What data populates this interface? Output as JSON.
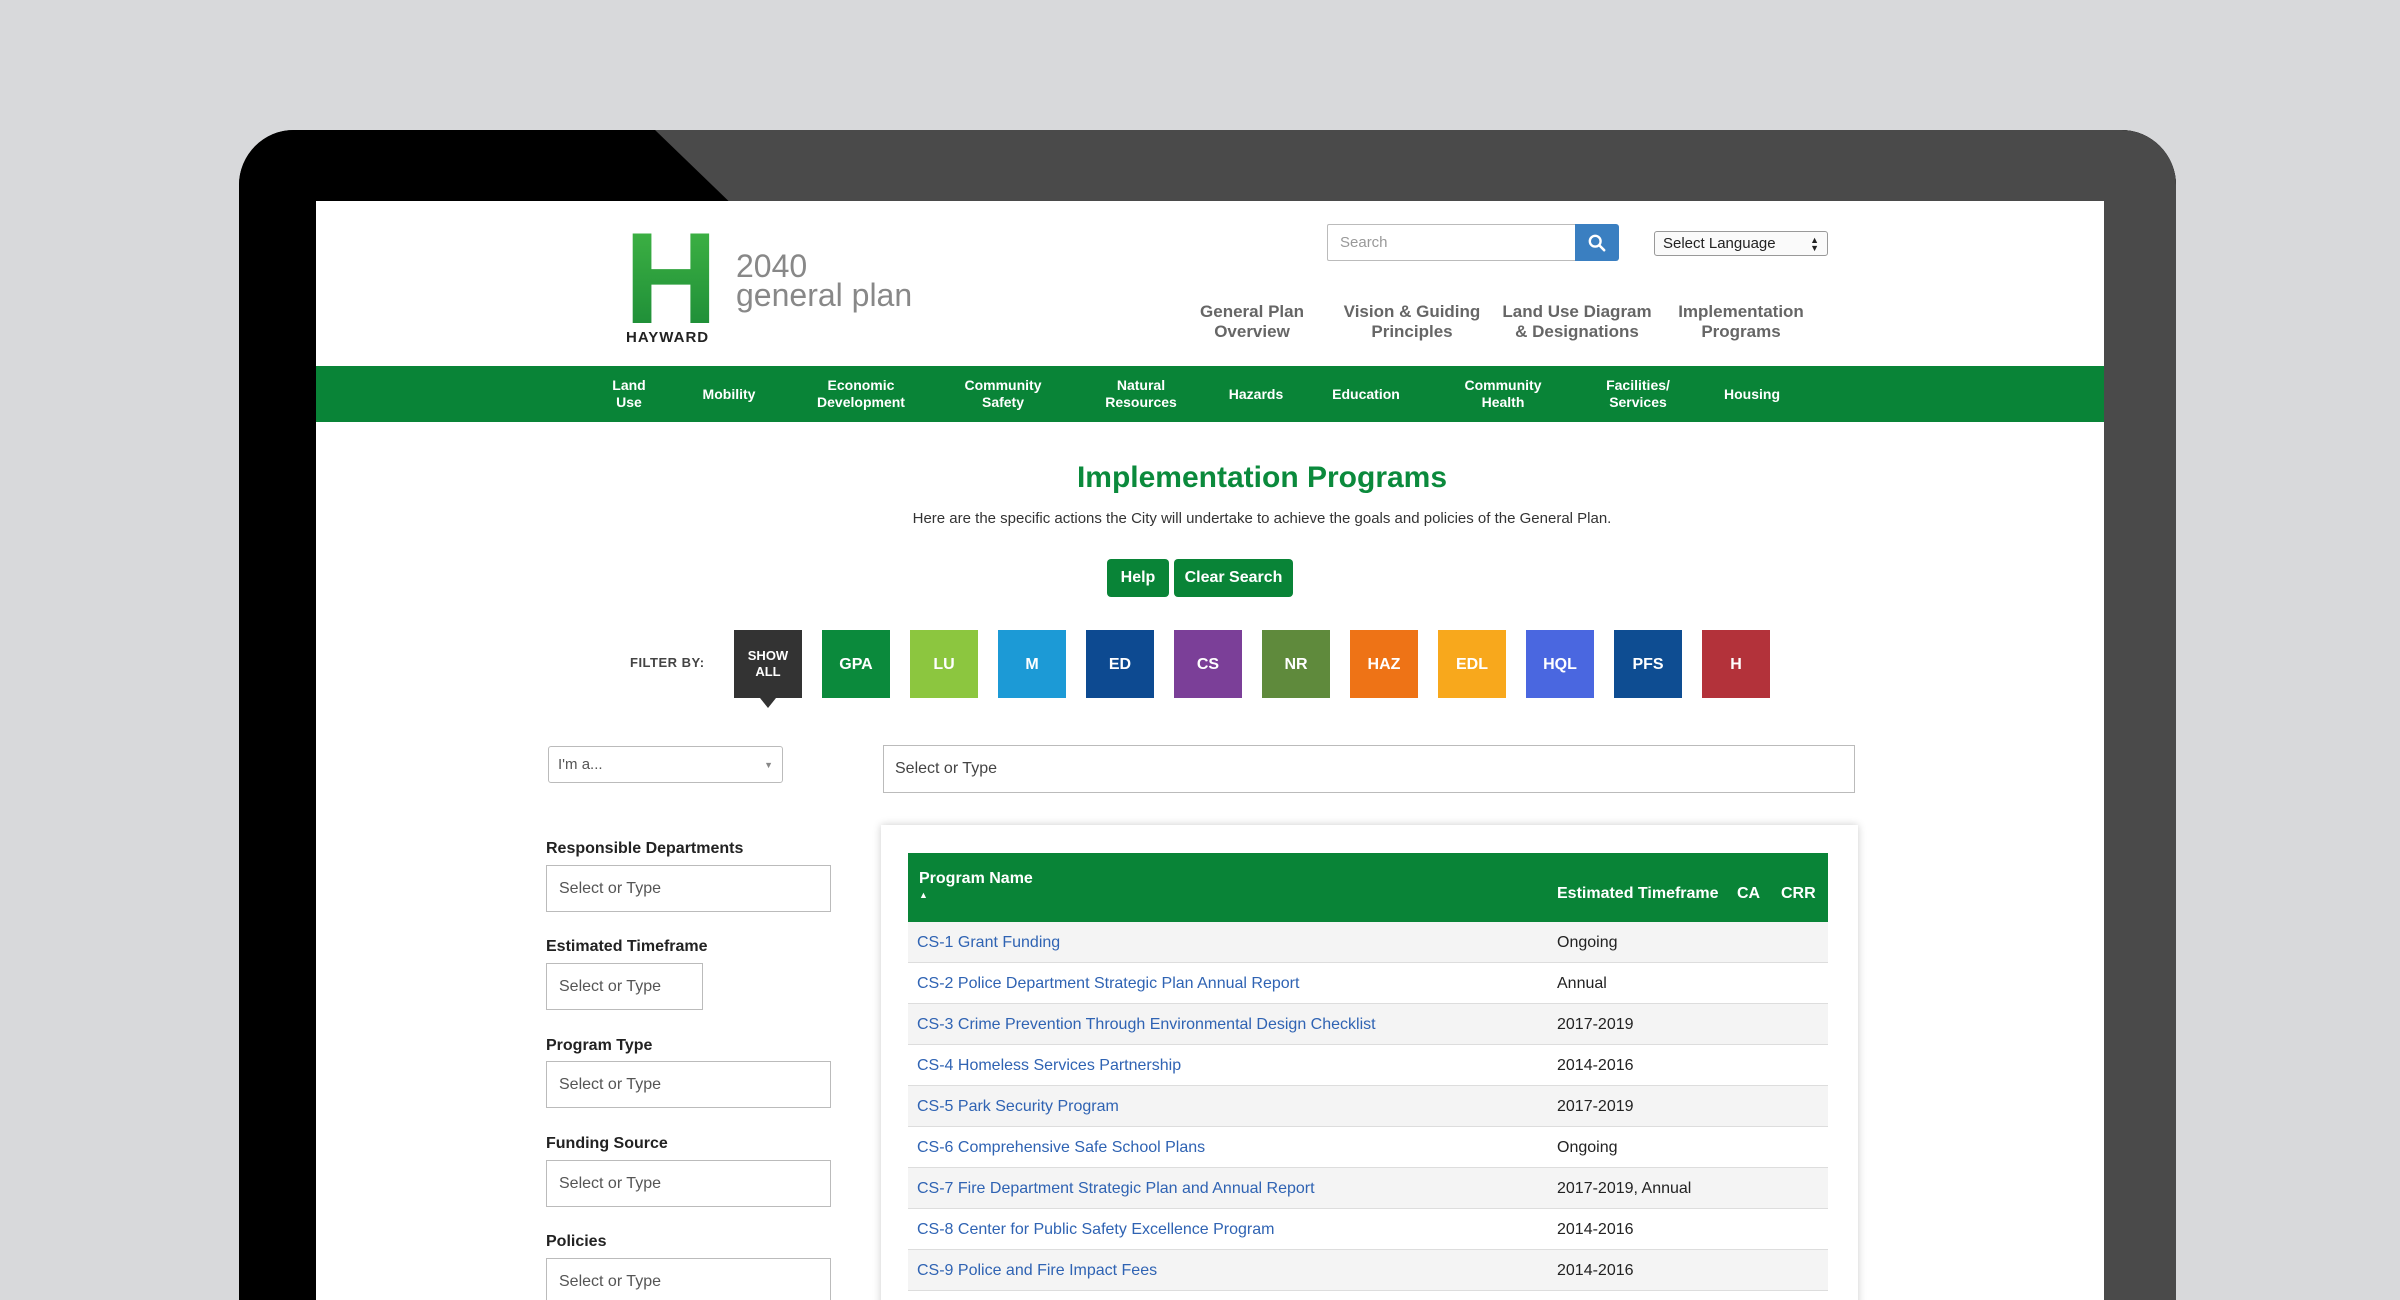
{
  "brand": {
    "year": "2040",
    "plan": "general plan",
    "city": "HAYWARD",
    "logo_letter": "H"
  },
  "header": {
    "search_placeholder": "Search",
    "language_select": "Select Language",
    "nav": [
      {
        "line1": "General Plan",
        "line2": "Overview"
      },
      {
        "line1": "Vision & Guiding",
        "line2": "Principles"
      },
      {
        "line1": "Land Use Diagram",
        "line2": "& Designations"
      },
      {
        "line1": "Implementation",
        "line2": "Programs"
      }
    ]
  },
  "greenbar": [
    {
      "line1": "Land",
      "line2": "Use"
    },
    {
      "line1": "Mobility",
      "line2": ""
    },
    {
      "line1": "Economic",
      "line2": "Development"
    },
    {
      "line1": "Community",
      "line2": "Safety"
    },
    {
      "line1": "Natural",
      "line2": "Resources"
    },
    {
      "line1": "Hazards",
      "line2": ""
    },
    {
      "line1": "Education",
      "line2": ""
    },
    {
      "line1": "Community",
      "line2": "Health"
    },
    {
      "line1": "Facilities/",
      "line2": "Services"
    },
    {
      "line1": "Housing",
      "line2": ""
    }
  ],
  "page": {
    "title": "Implementation Programs",
    "subtitle": "Here are the specific actions the City will undertake to achieve the goals and policies of the General Plan.",
    "help_label": "Help",
    "clear_label": "Clear Search"
  },
  "filter": {
    "label": "FILTER BY:",
    "tiles": [
      {
        "line1": "SHOW",
        "line2": "ALL",
        "color": "#333333"
      },
      {
        "line1": "GPA",
        "line2": "",
        "color": "#0b8a3c"
      },
      {
        "line1": "LU",
        "line2": "",
        "color": "#8cc63f"
      },
      {
        "line1": "M",
        "line2": "",
        "color": "#1c9ad6"
      },
      {
        "line1": "ED",
        "line2": "",
        "color": "#0d4a91"
      },
      {
        "line1": "CS",
        "line2": "",
        "color": "#7b3f98"
      },
      {
        "line1": "NR",
        "line2": "",
        "color": "#5f8a3c"
      },
      {
        "line1": "HAZ",
        "line2": "",
        "color": "#ee7316"
      },
      {
        "line1": "EDL",
        "line2": "",
        "color": "#f8a81c"
      },
      {
        "line1": "HQL",
        "line2": "",
        "color": "#4a67e0"
      },
      {
        "line1": "PFS",
        "line2": "",
        "color": "#0e4d92"
      },
      {
        "line1": "H",
        "line2": "",
        "color": "#b3323a"
      }
    ]
  },
  "search": {
    "ima_placeholder": "I'm a...",
    "main_placeholder": "Select or Type"
  },
  "sidebar": [
    {
      "label": "Responsible Departments",
      "placeholder": "Select or Type"
    },
    {
      "label": "Estimated Timeframe",
      "placeholder": "Select or Type"
    },
    {
      "label": "Program Type",
      "placeholder": "Select or Type"
    },
    {
      "label": "Funding Source",
      "placeholder": "Select or Type"
    },
    {
      "label": "Policies",
      "placeholder": "Select or Type"
    }
  ],
  "table": {
    "columns": {
      "name": "Program Name",
      "timeframe": "Estimated Timeframe",
      "ca": "CA",
      "crr": "CRR"
    },
    "rows": [
      {
        "name": "CS-1 Grant Funding",
        "timeframe": "Ongoing"
      },
      {
        "name": "CS-2 Police Department Strategic Plan Annual Report",
        "timeframe": "Annual"
      },
      {
        "name": "CS-3 Crime Prevention Through Environmental Design Checklist",
        "timeframe": "2017-2019"
      },
      {
        "name": "CS-4 Homeless Services Partnership",
        "timeframe": "2014-2016"
      },
      {
        "name": "CS-5 Park Security Program",
        "timeframe": "2017-2019"
      },
      {
        "name": "CS-6 Comprehensive Safe School Plans",
        "timeframe": "Ongoing"
      },
      {
        "name": "CS-7 Fire Department Strategic Plan and Annual Report",
        "timeframe": "2017-2019, Annual"
      },
      {
        "name": "CS-8 Center for Public Safety Excellence Program",
        "timeframe": "2014-2016"
      },
      {
        "name": "CS-9 Police and Fire Impact Fees",
        "timeframe": "2014-2016"
      }
    ]
  }
}
